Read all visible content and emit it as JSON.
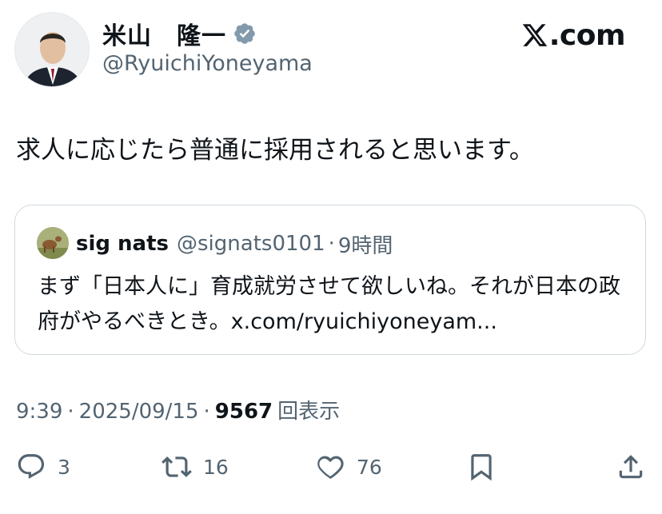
{
  "author": {
    "name": "米山　隆一",
    "handle": "@RyuichiYoneyama",
    "verified": true,
    "avatar_icon": "profile-photo"
  },
  "brand": {
    "logo_icon": "x-logo-icon",
    "domain_suffix": ".com"
  },
  "tweet": {
    "text": "求人に応じたら普通に採用されると思います。"
  },
  "quote": {
    "name": "sig nats",
    "handle": "@signats0101",
    "separator": "·",
    "time": "9時間",
    "text": "まず「日本人に」育成就労させて欲しいね。それが日本の政府がやるべきとき。x.com/ryuichiyoneyam..."
  },
  "meta": {
    "time": "9:39",
    "sep1": "·",
    "date": "2025/09/15",
    "sep2": "·",
    "views": "9567",
    "views_label": "回表示"
  },
  "actions": {
    "reply_count": "3",
    "retweet_count": "16",
    "like_count": "76"
  },
  "colors": {
    "text": "#0f1419",
    "secondary": "#536471",
    "border": "#cfd9de",
    "verified": "#829aab"
  }
}
